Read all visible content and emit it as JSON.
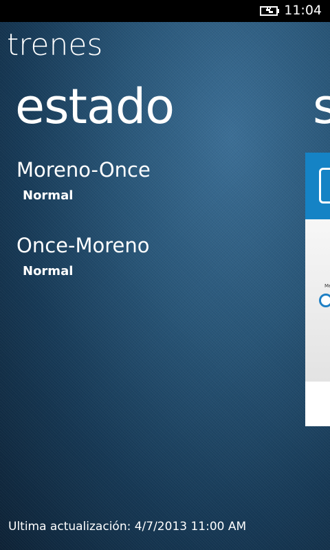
{
  "status_bar": {
    "time": "11:04",
    "battery_icon": "charging-battery-icon"
  },
  "app": {
    "title": "trenes"
  },
  "section": {
    "title": "estado",
    "next_peek": "s"
  },
  "routes": [
    {
      "name": "Moreno-Once",
      "status": "Normal"
    },
    {
      "name": "Once-Moreno",
      "status": "Normal"
    }
  ],
  "peek_panel": {
    "small_text": "Me"
  },
  "footer": {
    "text": "Ultima actualización: 4/7/2013 11:00 AM"
  },
  "colors": {
    "panel_accent": "#1583c5",
    "background": "#285577"
  }
}
